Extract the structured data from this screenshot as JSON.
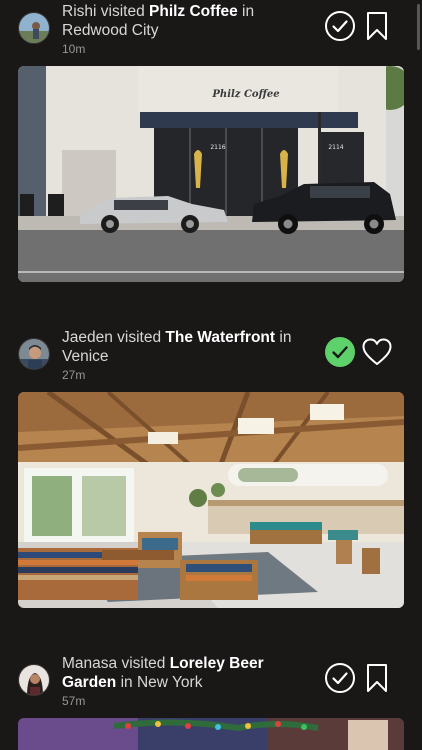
{
  "feed": {
    "posts": [
      {
        "user": "Rishi",
        "verb": "visited",
        "place": "Philz Coffee",
        "preposition": "in",
        "location": "Redwood City",
        "time": "10m",
        "checked": false,
        "second_action": "bookmark-icon",
        "photo": {
          "sign_text": "Philz Coffee",
          "address_left": "2116",
          "address_right": "2114"
        }
      },
      {
        "user": "Jaeden",
        "verb": "visited",
        "place": "The Waterfront",
        "preposition": "in",
        "location": "Venice",
        "time": "27m",
        "checked": true,
        "second_action": "heart-icon",
        "photo": {}
      },
      {
        "user": "Manasa",
        "verb": "visited",
        "place": "Loreley Beer Garden",
        "preposition": "in",
        "location": "New York",
        "time": "57m",
        "checked": false,
        "second_action": "bookmark-icon",
        "photo": {}
      }
    ]
  },
  "colors": {
    "background": "#1a1717",
    "text": "#d9d6d6",
    "text_bold": "#ffffff",
    "time": "#9a9595",
    "check_active": "#5fd16a"
  }
}
